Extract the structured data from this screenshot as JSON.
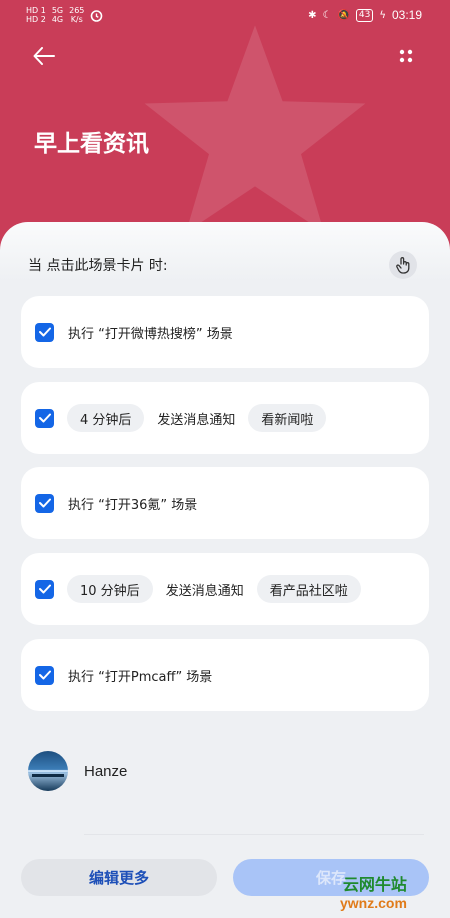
{
  "statusbar": {
    "net1": "HD 1",
    "net2": "HD 2",
    "signal1": "5G",
    "signal2": "4G",
    "speed": "265\nK/s",
    "battery": "43",
    "time": "03:19"
  },
  "header": {
    "title": "早上看资讯"
  },
  "trigger": {
    "label": "当 点击此场景卡片 时:"
  },
  "actions": [
    {
      "text": "执行 “打开微博热搜榜” 场景",
      "checked": true
    },
    {
      "delay": "4 分钟后",
      "verb": "发送消息通知",
      "message": "看新闻啦",
      "checked": true
    },
    {
      "text": "执行 “打开36氪” 场景",
      "checked": true
    },
    {
      "delay": "10 分钟后",
      "verb": "发送消息通知",
      "message": "看产品社区啦",
      "checked": true
    },
    {
      "text": "执行 “打开Pmcaff” 场景",
      "checked": true
    }
  ],
  "author": {
    "name": "Hanze"
  },
  "footer": {
    "edit_label": "编辑更多",
    "save_label": "保存"
  },
  "watermark": {
    "line1": "云网牛站",
    "line2": "ywnz.com"
  },
  "colors": {
    "header_bg": "#c93d58",
    "accent": "#1466e6",
    "save_disabled": "#a9c4f7"
  },
  "icons": {
    "back": "arrow-left-icon",
    "more": "four-dots-icon",
    "trigger": "tap-hand-icon",
    "check": "checkmark-icon"
  }
}
